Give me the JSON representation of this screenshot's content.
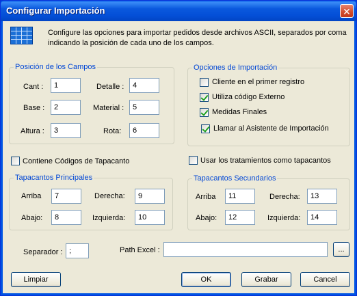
{
  "window": {
    "title": "Configurar Importación",
    "close_symbol": "✕"
  },
  "intro": "Configure las opciones para importar pedidos desde archivos ASCII, separados por coma indicando la posición de cada uno de los campos.",
  "posicion": {
    "legend": "Posición de los Campos",
    "cant": {
      "label": "Cant :",
      "value": "1"
    },
    "detalle": {
      "label": "Detalle :",
      "value": "4"
    },
    "base": {
      "label": "Base :",
      "value": "2"
    },
    "material": {
      "label": "Material :",
      "value": "5"
    },
    "altura": {
      "label": "Altura :",
      "value": "3"
    },
    "rota": {
      "label": "Rota:",
      "value": "6"
    }
  },
  "opciones": {
    "legend": "Opciones de Importación",
    "cliente": {
      "label": "Cliente en el primer registro",
      "checked": false
    },
    "codigo": {
      "label": "Utiliza código Externo",
      "checked": true
    },
    "medidas": {
      "label": "Medidas Finales",
      "checked": true
    },
    "asistente": {
      "label": "Llamar al Asistente de Importación",
      "checked": true
    }
  },
  "contiene": {
    "label": "Contiene Códigos de Tapacanto",
    "checked": false
  },
  "usar": {
    "label": "Usar los tratamientos como tapacantos",
    "checked": false
  },
  "principales": {
    "legend": "Tapacantos Principales",
    "arriba": {
      "label": "Arriba",
      "value": "7"
    },
    "derecha": {
      "label": "Derecha:",
      "value": "9"
    },
    "abajo": {
      "label": "Abajo:",
      "value": "8"
    },
    "izquierda": {
      "label": "Izquierda:",
      "value": "10"
    }
  },
  "secundarios": {
    "legend": "Tapacantos Secundarios",
    "arriba": {
      "label": "Arriba",
      "value": "11"
    },
    "derecha": {
      "label": "Derecha:",
      "value": "13"
    },
    "abajo": {
      "label": "Abajo:",
      "value": "12"
    },
    "izquierda": {
      "label": "Izquierda:",
      "value": "14"
    }
  },
  "separador": {
    "label": "Separador :",
    "value": ";"
  },
  "path_excel": {
    "label": "Path Excel :",
    "value": "",
    "browse_label": "..."
  },
  "buttons": {
    "limpiar": "Limpiar",
    "ok": "OK",
    "grabar": "Grabar",
    "cancel": "Cancel"
  },
  "colors": {
    "titlebar": "#0054e3",
    "legend_text": "#0046d5",
    "dialog_bg": "#ece9d8",
    "check_mark": "#21a121"
  }
}
